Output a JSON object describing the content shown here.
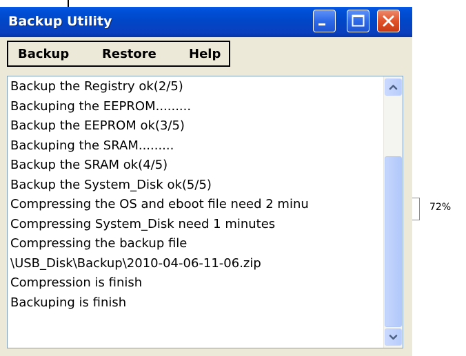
{
  "window": {
    "title": "Backup Utility"
  },
  "menu": {
    "backup": "Backup",
    "restore": "Restore",
    "help": "Help"
  },
  "log": {
    "lines": [
      "Backup the Registry ok(2/5)",
      "Backuping the EEPROM.........",
      "Backup the EEPROM ok(3/5)",
      "Backuping the SRAM.........",
      "Backup the SRAM ok(4/5)",
      "Backup the System_Disk ok(5/5)",
      "Compressing the OS and eboot file need 2 minu",
      "Compressing System_Disk need 1 minutes",
      "Compressing the backup file",
      "\\USB_Disk\\Backup\\2010-04-06-11-06.zip",
      "Compression is finish",
      "Backuping is finish"
    ]
  },
  "progress": {
    "label": "72%",
    "value": 72
  },
  "icons": {
    "minimize": "minimize-icon",
    "maximize": "maximize-icon",
    "close": "close-icon",
    "scroll_up": "chevron-up-icon",
    "scroll_down": "chevron-down-icon"
  },
  "colors": {
    "titlebar": "#0047c8",
    "close_button": "#e0522a",
    "window_bg": "#ece9d8",
    "scroll_accent": "#4d6185"
  }
}
